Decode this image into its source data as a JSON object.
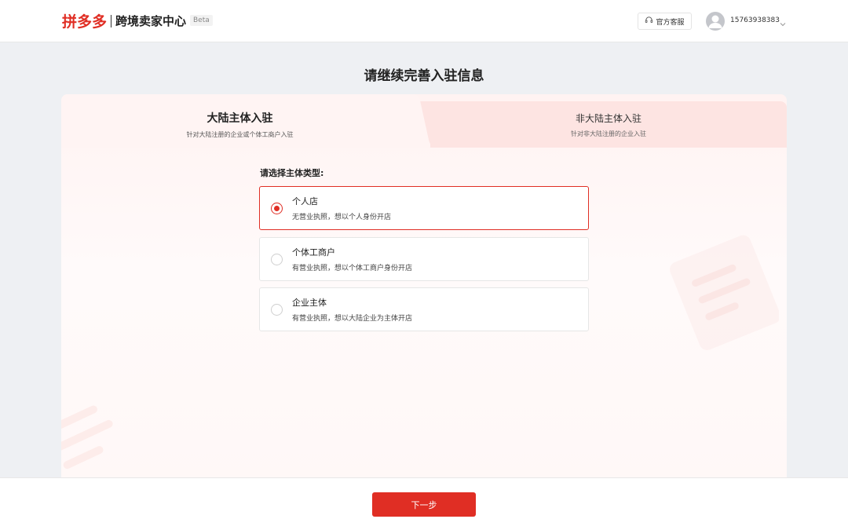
{
  "header": {
    "logo_text": "拼多多",
    "brand": "跨境卖家中心",
    "beta": "Beta",
    "service_label": "官方客服",
    "user_phone": "15763938383"
  },
  "page_title": "请继续完善入驻信息",
  "tabs": [
    {
      "title": "大陆主体入驻",
      "subtitle": "针对大陆注册的企业或个体工商户入驻",
      "active": true
    },
    {
      "title": "非大陆主体入驻",
      "subtitle": "针对非大陆注册的企业入驻",
      "active": false
    }
  ],
  "select_label": "请选择主体类型:",
  "options": [
    {
      "title": "个人店",
      "desc": "无营业执照，想以个人身份开店",
      "selected": true
    },
    {
      "title": "个体工商户",
      "desc": "有营业执照，想以个体工商户身份开店",
      "selected": false
    },
    {
      "title": "企业主体",
      "desc": "有营业执照，想以大陆企业为主体开店",
      "selected": false
    }
  ],
  "next_button": "下一步",
  "colors": {
    "accent": "#e02e24",
    "tab_inactive_bg": "#fde4e2",
    "page_bg": "#eef0f3"
  }
}
